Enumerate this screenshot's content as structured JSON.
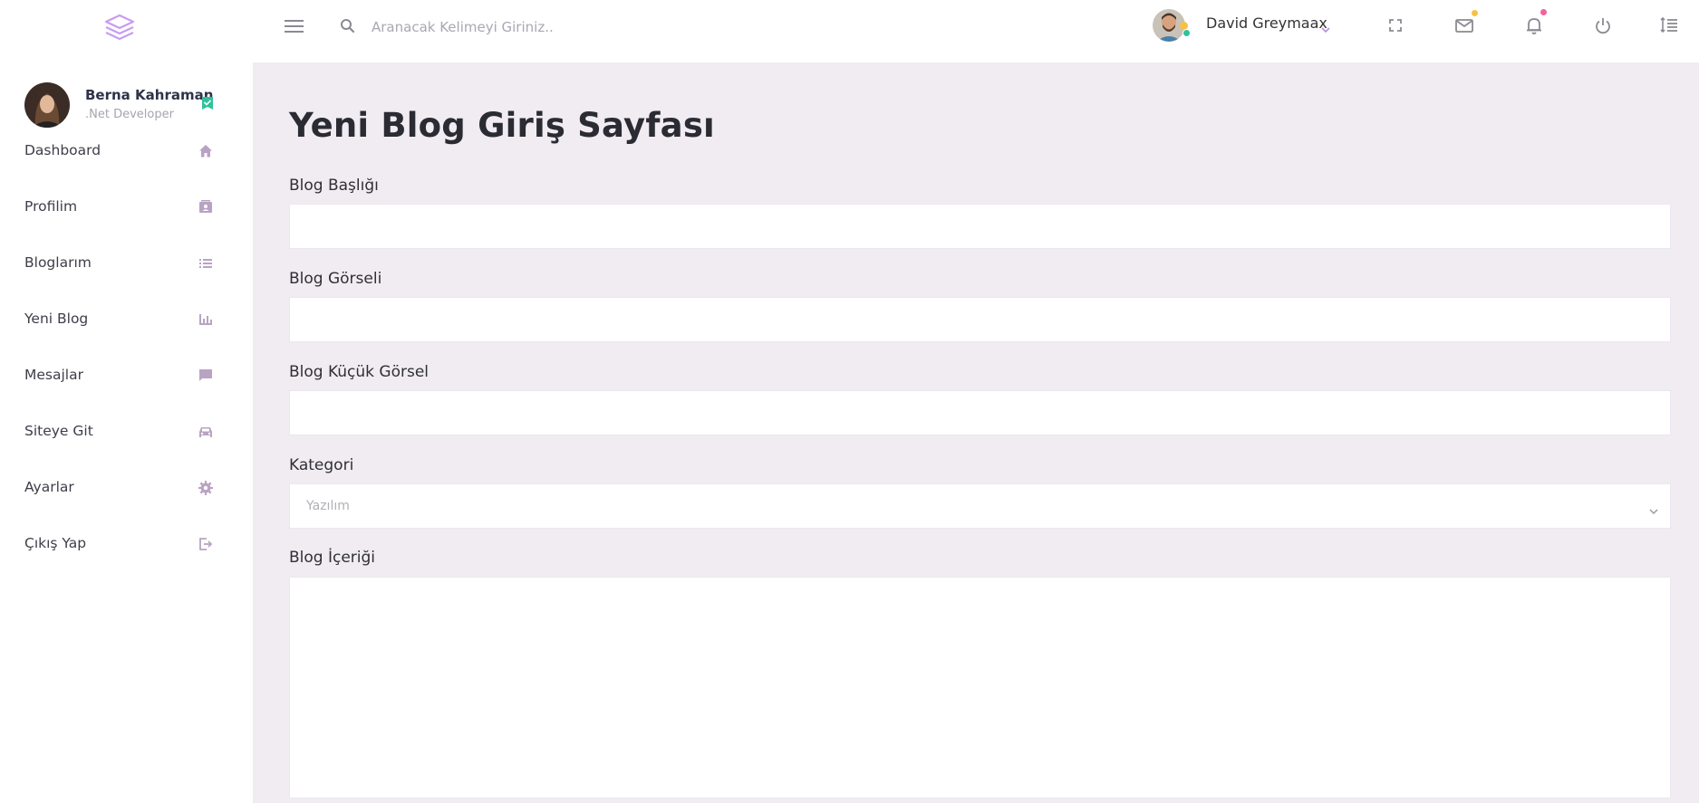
{
  "header": {
    "search_placeholder": "Aranacak Kelimeyi Giriniz..",
    "user_name": "David Greymaax",
    "icons": [
      "layers-logo-icon",
      "hamburger-menu-icon",
      "search-icon",
      "chevron-down-icon",
      "fullscreen-icon",
      "mail-icon",
      "bell-icon",
      "power-icon",
      "list-toggle-icon"
    ]
  },
  "sidebar": {
    "profile": {
      "name": "Berna Kahraman",
      "role": ".Net Developer"
    },
    "items": [
      {
        "label": "Dashboard",
        "icon": "home-icon"
      },
      {
        "label": "Profilim",
        "icon": "contact-card-icon"
      },
      {
        "label": "Bloglarım",
        "icon": "list-icon"
      },
      {
        "label": "Yeni Blog",
        "icon": "bar-chart-icon"
      },
      {
        "label": "Mesajlar",
        "icon": "chat-icon"
      },
      {
        "label": "Siteye Git",
        "icon": "car-icon"
      },
      {
        "label": "Ayarlar",
        "icon": "gear-icon"
      },
      {
        "label": "Çıkış Yap",
        "icon": "logout-icon"
      }
    ]
  },
  "main": {
    "title": "Yeni Blog Giriş Sayfası",
    "fields": {
      "blog_title_label": "Blog Başlığı",
      "blog_image_label": "Blog Görseli",
      "blog_thumb_label": "Blog Küçük Görsel",
      "category_label": "Kategori",
      "category_value": "Yazılım",
      "content_label": "Blog İçeriği"
    }
  },
  "colors": {
    "accent": "#b98ee0",
    "icon_muted": "#b9a3c3",
    "verified": "#2fc29b",
    "content_bg": "#f1ecf2",
    "mail_badge": "#f6c244",
    "bell_badge": "#f0659b"
  }
}
